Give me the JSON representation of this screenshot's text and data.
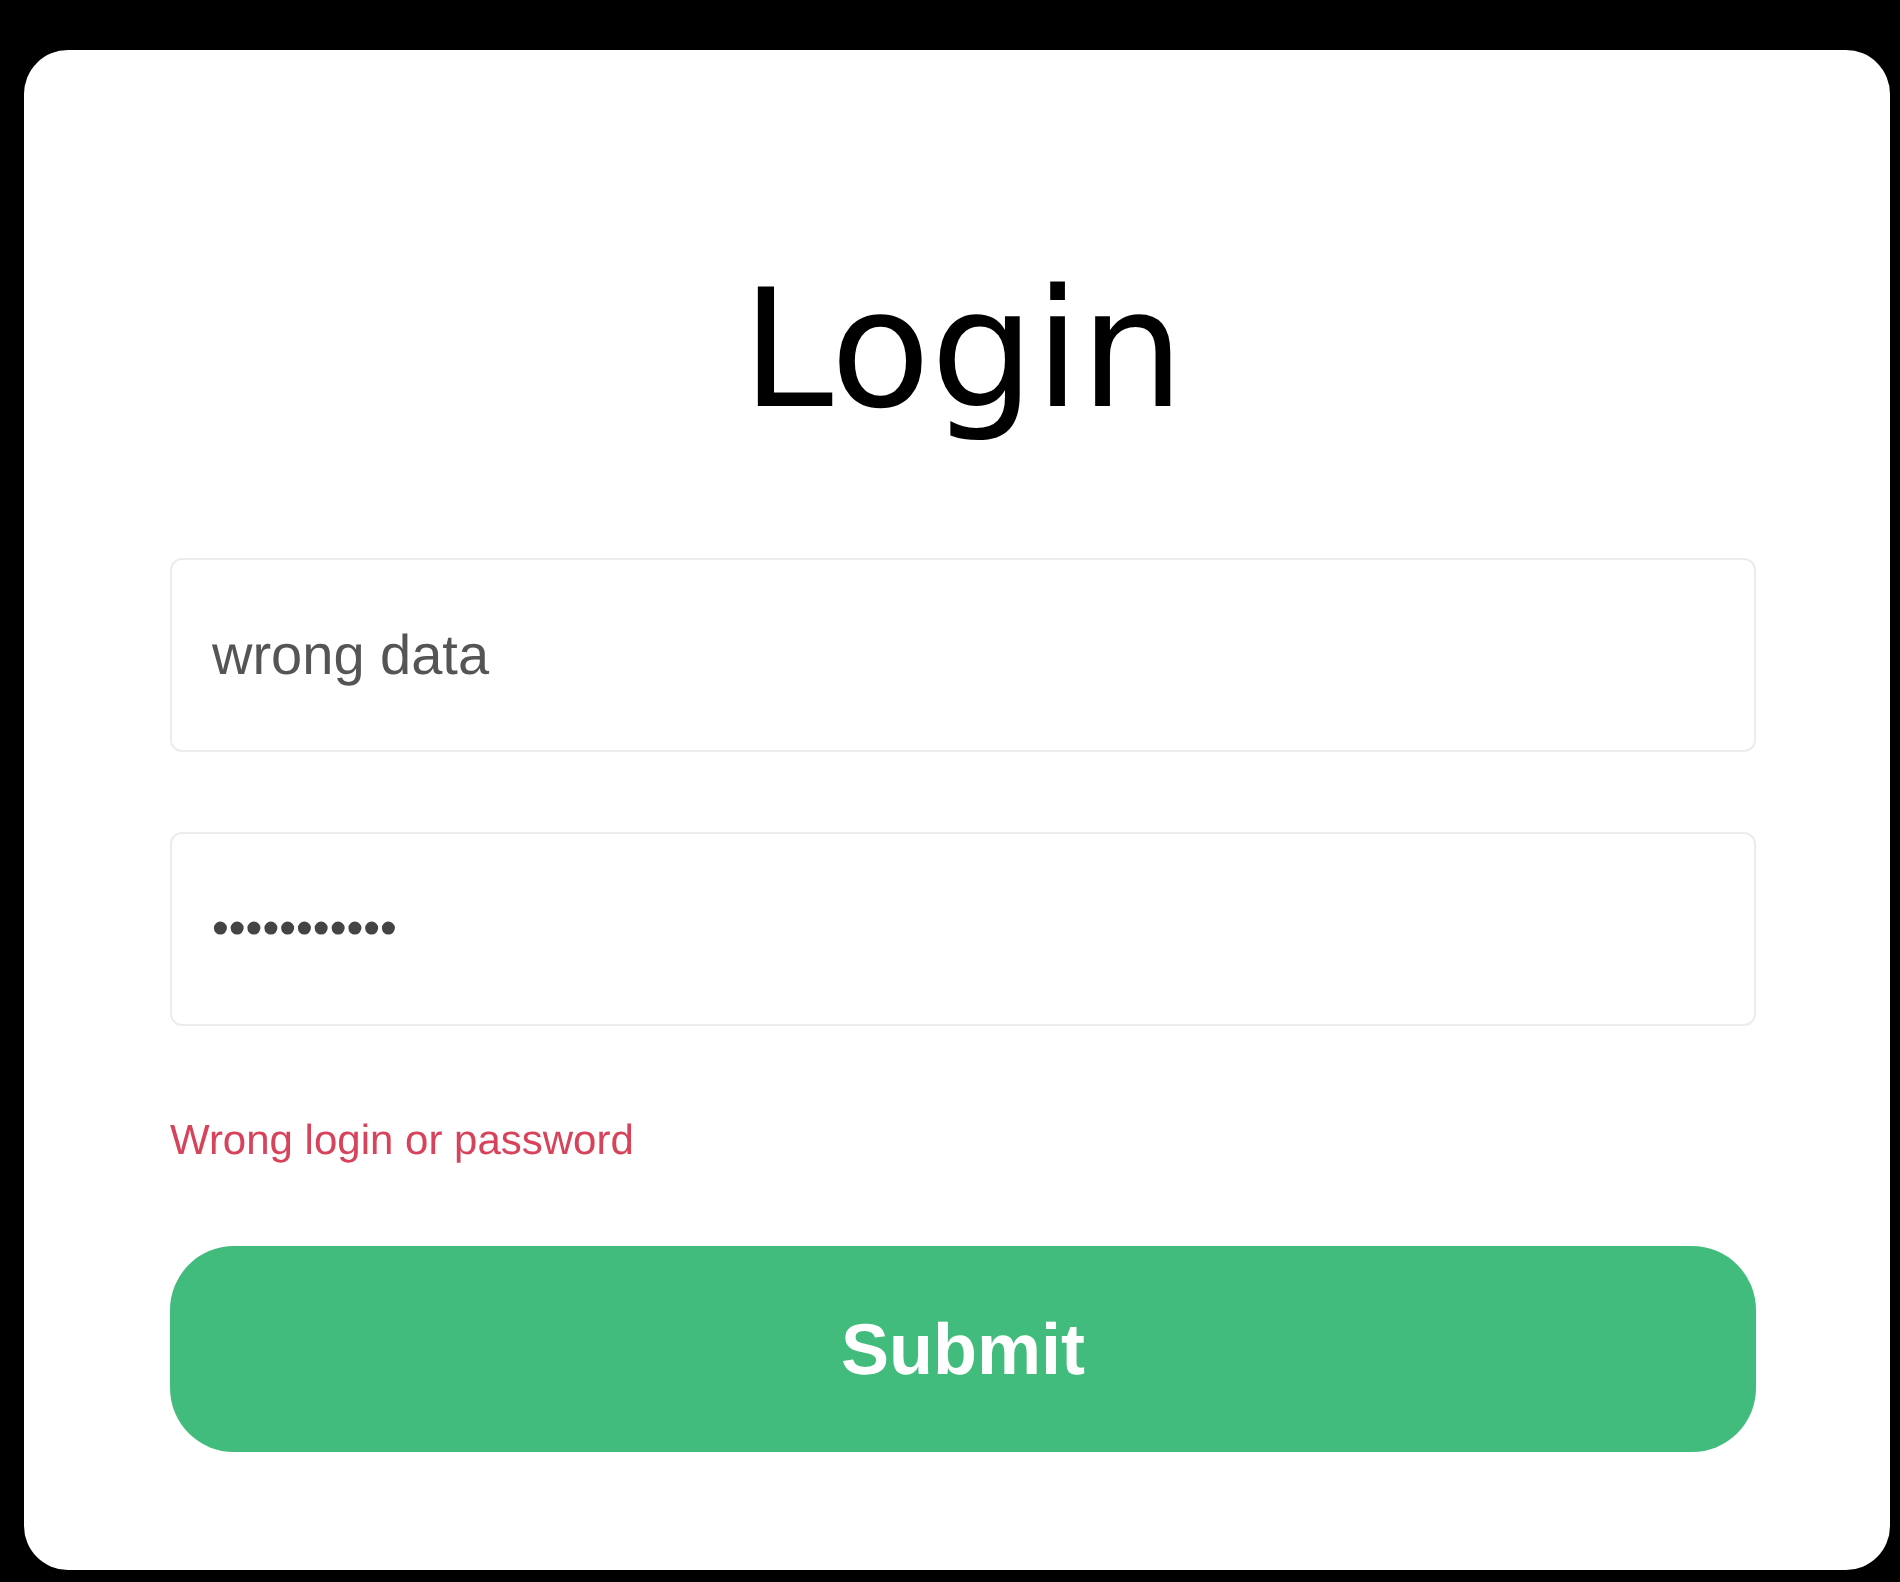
{
  "title": "Login",
  "fields": [
    {
      "kind": "text",
      "value": "wrong data"
    },
    {
      "kind": "password",
      "value": "•••••••••••"
    }
  ],
  "error": "Wrong login or password",
  "submit": "Submit"
}
